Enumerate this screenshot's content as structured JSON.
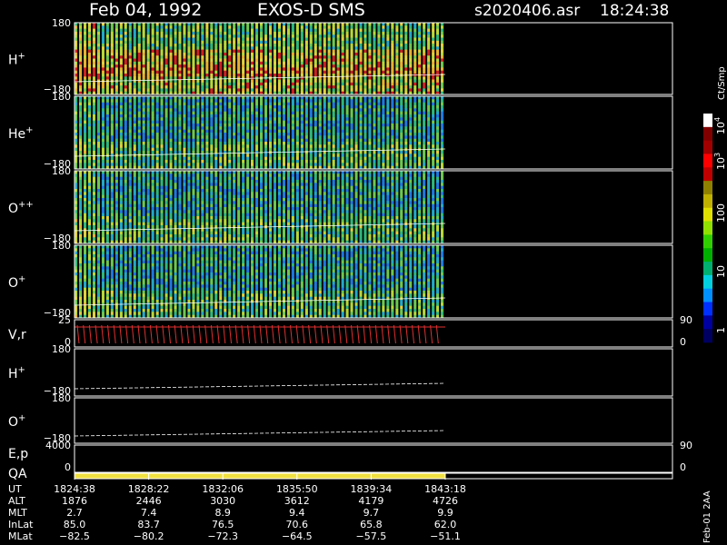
{
  "header": {
    "date": "Feb 04, 1992",
    "instrument": "EXOS-D SMS",
    "file": "s2020406.asr",
    "time": "18:24:38"
  },
  "colorbar": {
    "unit": "Ct/Smp",
    "ticks": [
      "1",
      "10",
      "100",
      "10",
      "10"
    ],
    "tick_exponents": [
      "",
      "",
      "",
      "3",
      "4"
    ],
    "colors": [
      "#000060",
      "#0000a0",
      "#0030ff",
      "#0090ff",
      "#00d0e0",
      "#00b070",
      "#00b000",
      "#30d000",
      "#90e000",
      "#e0e000",
      "#c0b000",
      "#908000",
      "#c00000",
      "#ff0000",
      "#a00000",
      "#800000",
      "#ffffff"
    ]
  },
  "chart_data": {
    "type": "heatmap",
    "title": "EXOS-D SMS",
    "date": "Feb 04, 1992",
    "panels": [
      {
        "label": "H",
        "sup": "+",
        "type": "spectrogram",
        "ymin": "−180",
        "ymax": "180"
      },
      {
        "label": "He",
        "sup": "+",
        "type": "spectrogram",
        "ymin": "−180",
        "ymax": "180"
      },
      {
        "label": "O",
        "sup": "++",
        "type": "spectrogram",
        "ymin": "−180",
        "ymax": "180"
      },
      {
        "label": "O",
        "sup": "+",
        "type": "spectrogram",
        "ymin": "−180",
        "ymax": "180"
      },
      {
        "label": "V,r",
        "sup": "",
        "type": "line",
        "ymin": "0",
        "ymax": "25",
        "right_min": "0",
        "right_max": "90"
      },
      {
        "label": "H",
        "sup": "+",
        "type": "angle",
        "ymin": "−180",
        "ymax": "180"
      },
      {
        "label": "O",
        "sup": "+",
        "type": "angle",
        "ymin": "−180",
        "ymax": "180"
      },
      {
        "label": "E,p",
        "sup": "",
        "type": "line",
        "ymin": "0",
        "ymax": "4000",
        "right_min": "0",
        "right_max": "90"
      },
      {
        "label": "QA",
        "sup": "",
        "type": "bar"
      }
    ],
    "ut_times": [
      "1824:38",
      "1828:22",
      "1832:06",
      "1835:50",
      "1839:34",
      "1843:18"
    ],
    "data_end_ut": "1843:18",
    "orbit_rows": [
      {
        "label": "UT",
        "values": [
          "1824:38",
          "1828:22",
          "1832:06",
          "1835:50",
          "1839:34",
          "1843:18"
        ]
      },
      {
        "label": "ALT",
        "values": [
          "1876",
          "2446",
          "3030",
          "3612",
          "4179",
          "4726"
        ]
      },
      {
        "label": "MLT",
        "values": [
          "2.7",
          "7.4",
          "8.9",
          "9.4",
          "9.7",
          "9.9"
        ]
      },
      {
        "label": "InLat",
        "values": [
          "85.0",
          "83.7",
          "76.5",
          "70.6",
          "65.8",
          "62.0"
        ]
      },
      {
        "label": "MLat",
        "values": [
          "−82.5",
          "−80.2",
          "−72.3",
          "−64.5",
          "−57.5",
          "−51.1"
        ]
      }
    ],
    "footer_note": "Feb-01 2AA"
  }
}
